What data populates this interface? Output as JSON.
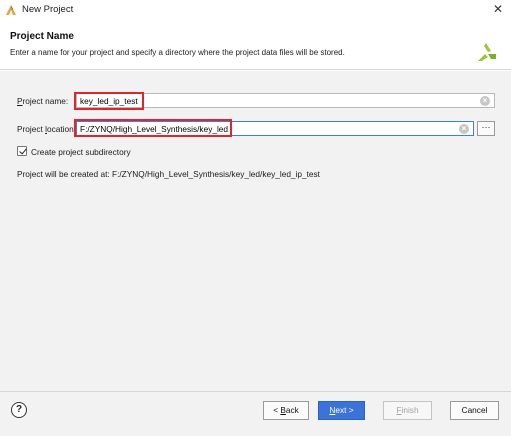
{
  "window": {
    "title": "New Project",
    "close_glyph": "✕"
  },
  "header": {
    "title": "Project Name",
    "description": "Enter a name for your project and specify a directory where the project data files will be stored.",
    "logo_icon": "xilinx-logo-icon"
  },
  "form": {
    "project_name": {
      "label_mnemonic": "P",
      "label_rest": "roject name:",
      "value": "key_led_ip_test"
    },
    "project_location": {
      "label_pre": "Project ",
      "label_mnemonic": "l",
      "label_rest": "ocation:",
      "value": "F:/ZYNQ/High_Level_Synthesis/key_led"
    },
    "browse_label": "···",
    "clear_glyph": "×",
    "subdirectory_checkbox": {
      "label": "Create project subdirectory",
      "checked": true
    },
    "created_at_text": "Project will be created at: F:/ZYNQ/High_Level_Synthesis/key_led/key_led_ip_test"
  },
  "footer": {
    "help_label": "?",
    "back": {
      "prefix": "< ",
      "mnemonic": "B",
      "rest": "ack"
    },
    "next": {
      "mnemonic": "N",
      "rest": "ext >"
    },
    "finish": {
      "mnemonic": "F",
      "rest": "inish"
    },
    "cancel": "Cancel"
  },
  "colors": {
    "highlight": "#e0262b",
    "accent": "#3b73d8",
    "logo_green": "#9bc53d"
  }
}
